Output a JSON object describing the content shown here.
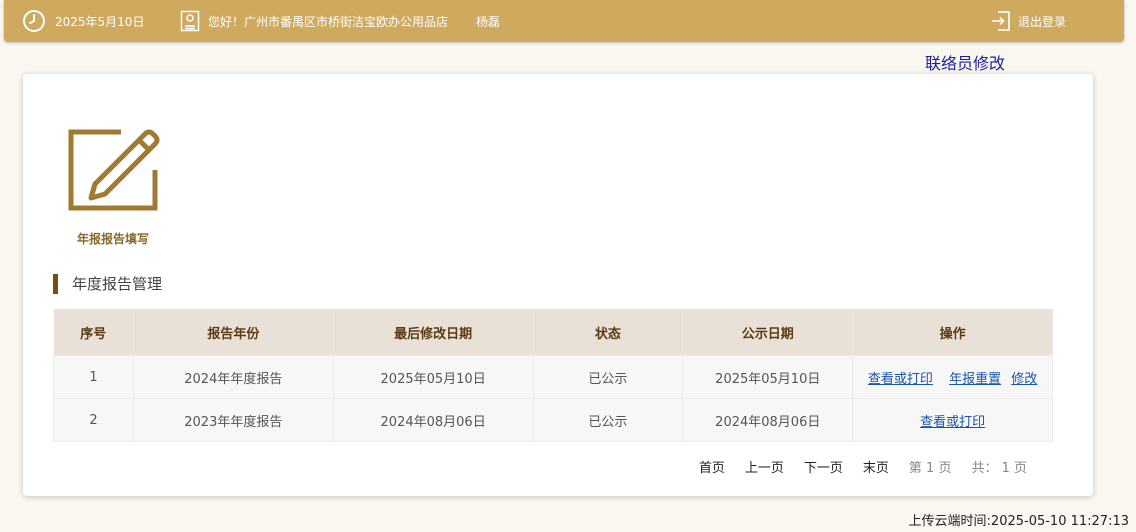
{
  "header": {
    "date": "2025年5月10日",
    "greeting": "您好！广州市番禺区市桥街洁宝欧办公用品店",
    "user": "杨磊",
    "logout": "退出登录"
  },
  "contact_link": "联络员修改",
  "tile": {
    "label": "年报报告填写"
  },
  "section_title": "年度报告管理",
  "table": {
    "headers": [
      "序号",
      "报告年份",
      "最后修改日期",
      "状态",
      "公示日期",
      "操作"
    ],
    "rows": [
      {
        "no": "1",
        "year": "2024年年度报告",
        "modified": "2025年05月10日",
        "status": "已公示",
        "published": "2025年05月10日",
        "ops": [
          "查看或打印",
          "年报重置",
          "修改"
        ]
      },
      {
        "no": "2",
        "year": "2023年年度报告",
        "modified": "2024年08月06日",
        "status": "已公示",
        "published": "2024年08月06日",
        "ops": [
          "查看或打印"
        ]
      }
    ]
  },
  "pager": {
    "first": "首页",
    "prev": "上一页",
    "next": "下一页",
    "last": "末页",
    "current": "第 1 页",
    "total": "共： 1 页"
  },
  "upload_time": "上传云端时间:2025-05-10 11:27:13"
}
